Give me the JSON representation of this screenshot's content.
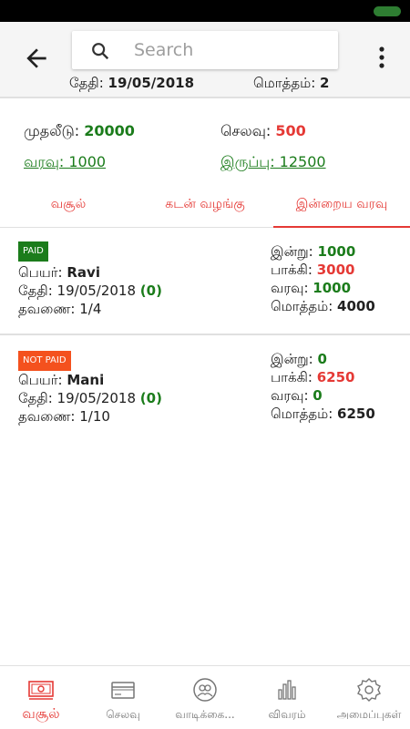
{
  "header": {
    "search_placeholder": "Search",
    "date_label": "தேதி:",
    "date_value": "19/05/2018",
    "total_label": "மொத்தம்:",
    "total_value": "2"
  },
  "summary": {
    "investment_label": "முதலீடு:",
    "investment_value": "20000",
    "expense_label": "செலவு:",
    "expense_value": "500",
    "income_link": "வரவு: 1000",
    "balance_link": "இருப்பு: 12500"
  },
  "tabs": [
    {
      "label": "வசூல்",
      "active": false
    },
    {
      "label": "கடன் வழங்கு",
      "active": false
    },
    {
      "label": "இன்றைய வரவு",
      "active": true
    }
  ],
  "labels": {
    "name": "பெயர்:",
    "date": "தேதி:",
    "installment": "தவணை:",
    "today": "இன்று:",
    "pending": "பாக்கி:",
    "received": "வரவு:",
    "total": "மொத்தம்:"
  },
  "entries": [
    {
      "status": "PAID",
      "name": "Ravi",
      "date": "19/05/2018",
      "date_count": "(0)",
      "installment": "1/4",
      "today": "1000",
      "pending": "3000",
      "received": "1000",
      "total": "4000"
    },
    {
      "status": "NOT PAID",
      "name": "Mani",
      "date": "19/05/2018",
      "date_count": "(0)",
      "installment": "1/10",
      "today": "0",
      "pending": "6250",
      "received": "0",
      "total": "6250"
    }
  ],
  "bottom_nav": [
    {
      "label": "வசூல்",
      "icon": "cash-icon",
      "active": true
    },
    {
      "label": "செலவு",
      "icon": "card-icon",
      "active": false
    },
    {
      "label": "வாடிக்கை...",
      "icon": "customers-icon",
      "active": false
    },
    {
      "label": "விவரம்",
      "icon": "stats-icon",
      "active": false
    },
    {
      "label": "அமைப்புகள்",
      "icon": "settings-icon",
      "active": false
    }
  ],
  "colors": {
    "accent": "#e53935",
    "positive": "#1b7c1b",
    "not_paid": "#f4511e"
  }
}
